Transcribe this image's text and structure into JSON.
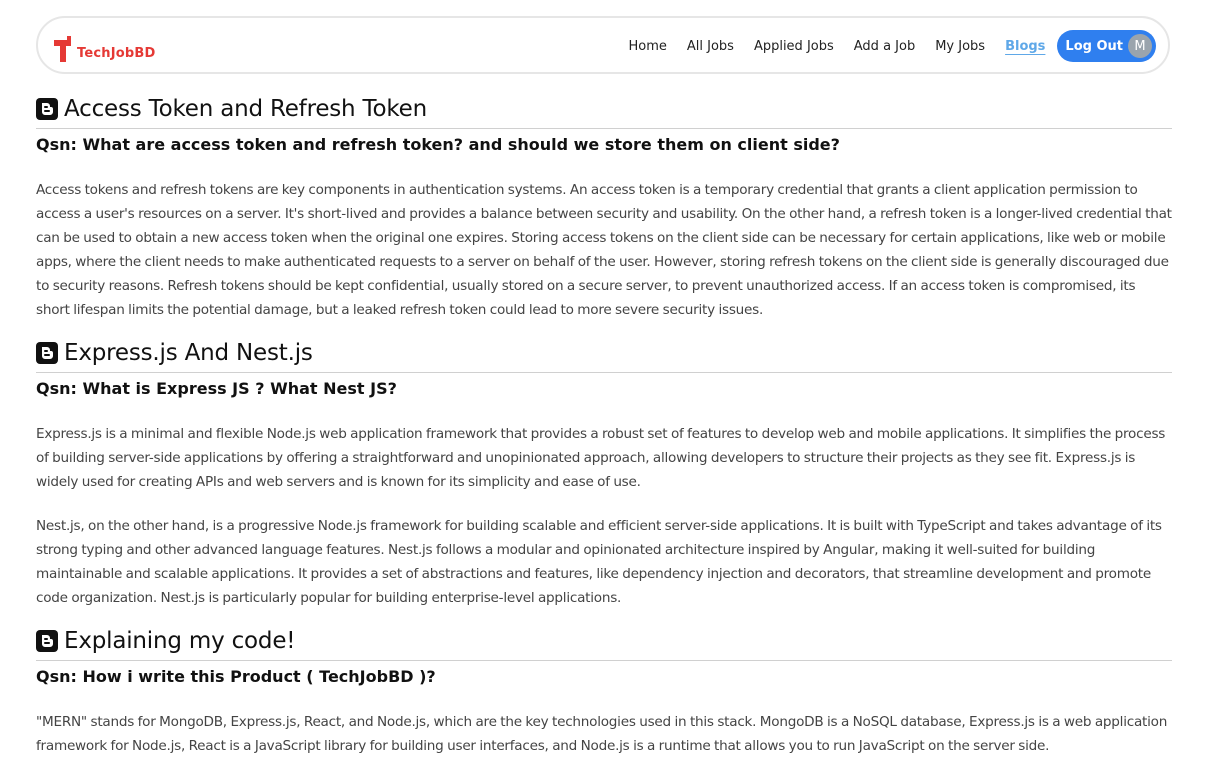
{
  "brand": {
    "name": "TechJobBD"
  },
  "nav": {
    "home": "Home",
    "all_jobs": "All Jobs",
    "applied_jobs": "Applied Jobs",
    "add_job": "Add a Job",
    "my_jobs": "My Jobs",
    "blogs": "Blogs",
    "logout": "Log Out",
    "avatar_initial": "M"
  },
  "colors": {
    "brand": "#e53935",
    "accent": "#2f7fef",
    "active_link": "#5fa8e8"
  },
  "sections": [
    {
      "icon": "blogger-icon",
      "title": "Access Token and Refresh Token",
      "question": "Qsn: What are access token and refresh token? and should we store them on client side?",
      "paragraphs": [
        "Access tokens and refresh tokens are key components in authentication systems. An access token is a temporary credential that grants a client application permission to access a user's resources on a server. It's short-lived and provides a balance between security and usability. On the other hand, a refresh token is a longer-lived credential that can be used to obtain a new access token when the original one expires. Storing access tokens on the client side can be necessary for certain applications, like web or mobile apps, where the client needs to make authenticated requests to a server on behalf of the user. However, storing refresh tokens on the client side is generally discouraged due to security reasons. Refresh tokens should be kept confidential, usually stored on a secure server, to prevent unauthorized access. If an access token is compromised, its short lifespan limits the potential damage, but a leaked refresh token could lead to more severe security issues."
      ]
    },
    {
      "icon": "blogger-icon",
      "title": "Express.js And Nest.js",
      "question": "Qsn: What is Express JS ? What Nest JS?",
      "paragraphs": [
        "Express.js is a minimal and flexible Node.js web application framework that provides a robust set of features to develop web and mobile applications. It simplifies the process of building server-side applications by offering a straightforward and unopinionated approach, allowing developers to structure their projects as they see fit. Express.js is widely used for creating APIs and web servers and is known for its simplicity and ease of use.",
        "Nest.js, on the other hand, is a progressive Node.js framework for building scalable and efficient server-side applications. It is built with TypeScript and takes advantage of its strong typing and other advanced language features. Nest.js follows a modular and opinionated architecture inspired by Angular, making it well-suited for building maintainable and scalable applications. It provides a set of abstractions and features, like dependency injection and decorators, that streamline development and promote code organization. Nest.js is particularly popular for building enterprise-level applications."
      ]
    },
    {
      "icon": "blogger-icon",
      "title": "Explaining my code!",
      "question": "Qsn: How i write this Product ( TechJobBD )?",
      "paragraphs": [
        "\"MERN\" stands for MongoDB, Express.js, React, and Node.js, which are the key technologies used in this stack. MongoDB is a NoSQL database, Express.js is a web application framework for Node.js, React is a JavaScript library for building user interfaces, and Node.js is a runtime that allows you to run JavaScript on the server side."
      ]
    }
  ]
}
